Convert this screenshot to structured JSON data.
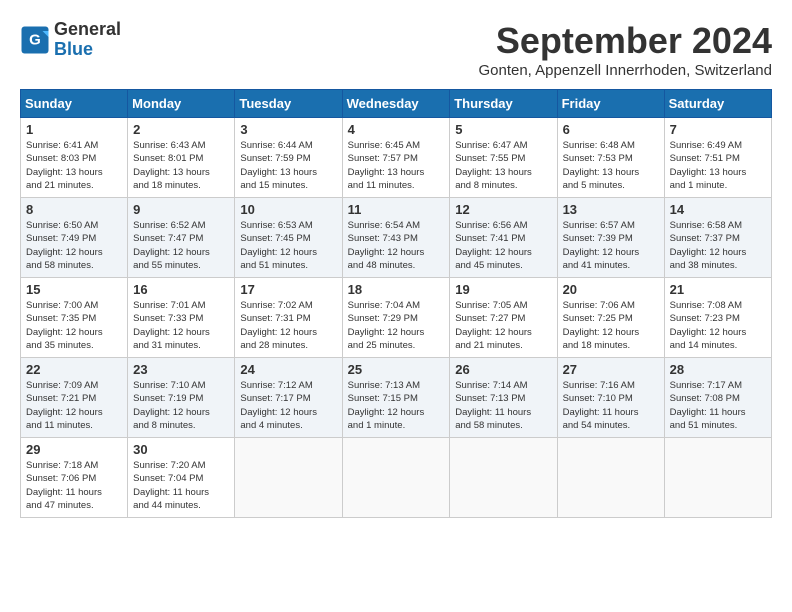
{
  "header": {
    "logo_line1": "General",
    "logo_line2": "Blue",
    "month": "September 2024",
    "location": "Gonten, Appenzell Innerrhoden, Switzerland"
  },
  "weekdays": [
    "Sunday",
    "Monday",
    "Tuesday",
    "Wednesday",
    "Thursday",
    "Friday",
    "Saturday"
  ],
  "weeks": [
    [
      {
        "day": "1",
        "sunrise": "6:41 AM",
        "sunset": "8:03 PM",
        "daylight": "13 hours and 21 minutes."
      },
      {
        "day": "2",
        "sunrise": "6:43 AM",
        "sunset": "8:01 PM",
        "daylight": "13 hours and 18 minutes."
      },
      {
        "day": "3",
        "sunrise": "6:44 AM",
        "sunset": "7:59 PM",
        "daylight": "13 hours and 15 minutes."
      },
      {
        "day": "4",
        "sunrise": "6:45 AM",
        "sunset": "7:57 PM",
        "daylight": "13 hours and 11 minutes."
      },
      {
        "day": "5",
        "sunrise": "6:47 AM",
        "sunset": "7:55 PM",
        "daylight": "13 hours and 8 minutes."
      },
      {
        "day": "6",
        "sunrise": "6:48 AM",
        "sunset": "7:53 PM",
        "daylight": "13 hours and 5 minutes."
      },
      {
        "day": "7",
        "sunrise": "6:49 AM",
        "sunset": "7:51 PM",
        "daylight": "13 hours and 1 minute."
      }
    ],
    [
      {
        "day": "8",
        "sunrise": "6:50 AM",
        "sunset": "7:49 PM",
        "daylight": "12 hours and 58 minutes."
      },
      {
        "day": "9",
        "sunrise": "6:52 AM",
        "sunset": "7:47 PM",
        "daylight": "12 hours and 55 minutes."
      },
      {
        "day": "10",
        "sunrise": "6:53 AM",
        "sunset": "7:45 PM",
        "daylight": "12 hours and 51 minutes."
      },
      {
        "day": "11",
        "sunrise": "6:54 AM",
        "sunset": "7:43 PM",
        "daylight": "12 hours and 48 minutes."
      },
      {
        "day": "12",
        "sunrise": "6:56 AM",
        "sunset": "7:41 PM",
        "daylight": "12 hours and 45 minutes."
      },
      {
        "day": "13",
        "sunrise": "6:57 AM",
        "sunset": "7:39 PM",
        "daylight": "12 hours and 41 minutes."
      },
      {
        "day": "14",
        "sunrise": "6:58 AM",
        "sunset": "7:37 PM",
        "daylight": "12 hours and 38 minutes."
      }
    ],
    [
      {
        "day": "15",
        "sunrise": "7:00 AM",
        "sunset": "7:35 PM",
        "daylight": "12 hours and 35 minutes."
      },
      {
        "day": "16",
        "sunrise": "7:01 AM",
        "sunset": "7:33 PM",
        "daylight": "12 hours and 31 minutes."
      },
      {
        "day": "17",
        "sunrise": "7:02 AM",
        "sunset": "7:31 PM",
        "daylight": "12 hours and 28 minutes."
      },
      {
        "day": "18",
        "sunrise": "7:04 AM",
        "sunset": "7:29 PM",
        "daylight": "12 hours and 25 minutes."
      },
      {
        "day": "19",
        "sunrise": "7:05 AM",
        "sunset": "7:27 PM",
        "daylight": "12 hours and 21 minutes."
      },
      {
        "day": "20",
        "sunrise": "7:06 AM",
        "sunset": "7:25 PM",
        "daylight": "12 hours and 18 minutes."
      },
      {
        "day": "21",
        "sunrise": "7:08 AM",
        "sunset": "7:23 PM",
        "daylight": "12 hours and 14 minutes."
      }
    ],
    [
      {
        "day": "22",
        "sunrise": "7:09 AM",
        "sunset": "7:21 PM",
        "daylight": "12 hours and 11 minutes."
      },
      {
        "day": "23",
        "sunrise": "7:10 AM",
        "sunset": "7:19 PM",
        "daylight": "12 hours and 8 minutes."
      },
      {
        "day": "24",
        "sunrise": "7:12 AM",
        "sunset": "7:17 PM",
        "daylight": "12 hours and 4 minutes."
      },
      {
        "day": "25",
        "sunrise": "7:13 AM",
        "sunset": "7:15 PM",
        "daylight": "12 hours and 1 minute."
      },
      {
        "day": "26",
        "sunrise": "7:14 AM",
        "sunset": "7:13 PM",
        "daylight": "11 hours and 58 minutes."
      },
      {
        "day": "27",
        "sunrise": "7:16 AM",
        "sunset": "7:10 PM",
        "daylight": "11 hours and 54 minutes."
      },
      {
        "day": "28",
        "sunrise": "7:17 AM",
        "sunset": "7:08 PM",
        "daylight": "11 hours and 51 minutes."
      }
    ],
    [
      {
        "day": "29",
        "sunrise": "7:18 AM",
        "sunset": "7:06 PM",
        "daylight": "11 hours and 47 minutes."
      },
      {
        "day": "30",
        "sunrise": "7:20 AM",
        "sunset": "7:04 PM",
        "daylight": "11 hours and 44 minutes."
      },
      null,
      null,
      null,
      null,
      null
    ]
  ]
}
